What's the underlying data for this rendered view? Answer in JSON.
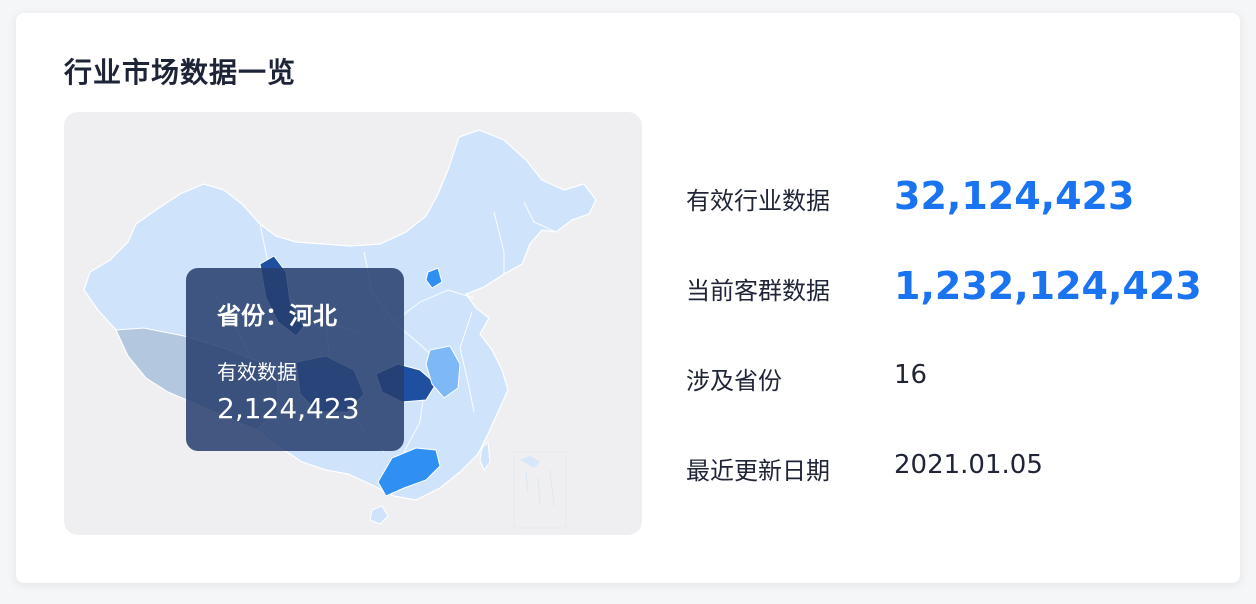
{
  "title": "行业市场数据一览",
  "map": {
    "tooltip": {
      "province": "省份：河北",
      "metric_label": "有效数据",
      "metric_value": "2,124,423"
    },
    "colors": {
      "panel_bg": "#efeff1",
      "region_light": "#cfe3fb",
      "region_mid": "#7fb8f7",
      "region_strong": "#2f8ff3",
      "region_dark": "#1f4fa0",
      "tibet": "#b3c8df"
    }
  },
  "stats": [
    {
      "label": "有效行业数据",
      "value": "32,124,423",
      "style": "big"
    },
    {
      "label": "当前客群数据",
      "value": "1,232,124,423",
      "style": "big"
    },
    {
      "label": "涉及省份",
      "value": "16",
      "style": "normal"
    },
    {
      "label": "最近更新日期",
      "value": "2021.01.05",
      "style": "normal"
    }
  ]
}
